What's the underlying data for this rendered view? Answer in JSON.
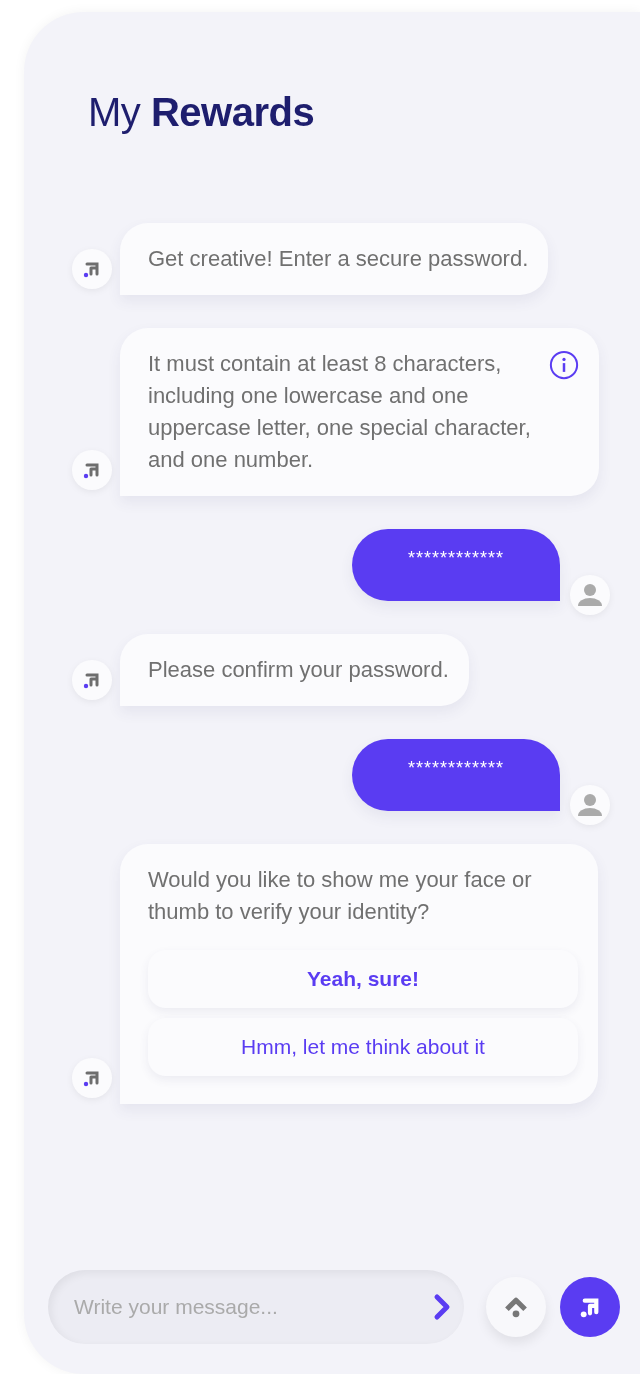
{
  "header": {
    "title": "My **Rewards**"
  },
  "messages": [
    {
      "kind": "bot",
      "text": "Get creative! Enter a secure password.",
      "info": false
    },
    {
      "kind": "bot",
      "text": "It must contain at least 8 characters, including one lowercase and one uppercase letter, one special character, and one number.",
      "info": true
    },
    {
      "kind": "user",
      "text": "************"
    },
    {
      "kind": "bot",
      "text": "Please confirm your password.",
      "info": false
    },
    {
      "kind": "user",
      "text": "************"
    },
    {
      "kind": "bot",
      "text": "Would you like to show me your face or thumb to verify your identity?",
      "info": false,
      "options": [
        {
          "label": "Yeah, sure!",
          "emphasized": true
        },
        {
          "label": "Hmm, let me think about it",
          "emphasized": false
        }
      ]
    }
  ],
  "composer": {
    "placeholder": "Write your message..."
  }
}
